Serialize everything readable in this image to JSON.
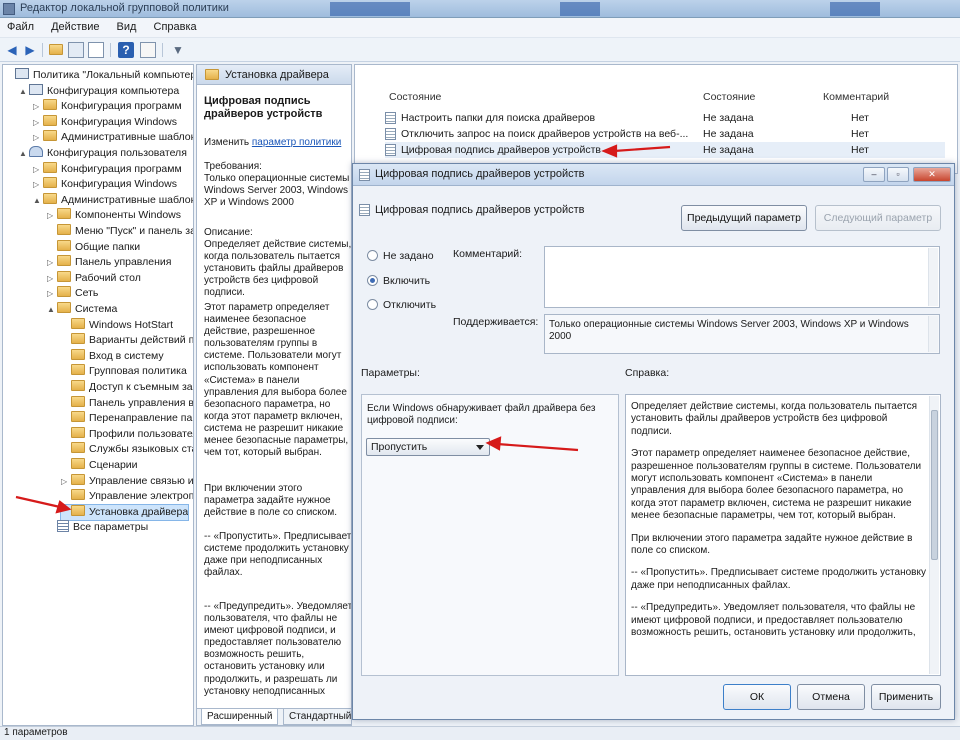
{
  "window": {
    "title": "Редактор локальной групповой политики"
  },
  "menu": {
    "items": [
      "Файл",
      "Действие",
      "Вид",
      "Справка"
    ]
  },
  "toolbar": {
    "icons": [
      "back-icon",
      "forward-icon",
      "up-folder-icon",
      "show-hide-tree-icon",
      "export-list-icon",
      "help-icon",
      "properties-icon",
      "filter-icon"
    ]
  },
  "tree": {
    "items": [
      {
        "label": "Политика \"Локальный компьютер\"",
        "indent": 0,
        "icon": "computer-policy-icon",
        "arrow": ""
      },
      {
        "label": "Конфигурация компьютера",
        "indent": 1,
        "icon": "computer-icon",
        "arrow": "▲"
      },
      {
        "label": "Конфигурация программ",
        "indent": 2,
        "icon": "folder-icon",
        "arrow": "▷"
      },
      {
        "label": "Конфигурация Windows",
        "indent": 2,
        "icon": "folder-icon",
        "arrow": "▷"
      },
      {
        "label": "Административные шаблоны",
        "indent": 2,
        "icon": "folder-icon",
        "arrow": "▷"
      },
      {
        "label": "Конфигурация пользователя",
        "indent": 1,
        "icon": "user-icon",
        "arrow": "▲"
      },
      {
        "label": "Конфигурация программ",
        "indent": 2,
        "icon": "folder-icon",
        "arrow": "▷"
      },
      {
        "label": "Конфигурация Windows",
        "indent": 2,
        "icon": "folder-icon",
        "arrow": "▷"
      },
      {
        "label": "Административные шаблоны",
        "indent": 2,
        "icon": "folder-icon",
        "arrow": "▲"
      },
      {
        "label": "Компоненты Windows",
        "indent": 3,
        "icon": "folder-icon",
        "arrow": "▷"
      },
      {
        "label": "Меню \"Пуск\" и панель за",
        "indent": 3,
        "icon": "folder-icon",
        "arrow": ""
      },
      {
        "label": "Общие папки",
        "indent": 3,
        "icon": "folder-icon",
        "arrow": ""
      },
      {
        "label": "Панель управления",
        "indent": 3,
        "icon": "folder-icon",
        "arrow": "▷"
      },
      {
        "label": "Рабочий стол",
        "indent": 3,
        "icon": "folder-icon",
        "arrow": "▷"
      },
      {
        "label": "Сеть",
        "indent": 3,
        "icon": "folder-icon",
        "arrow": "▷"
      },
      {
        "label": "Система",
        "indent": 3,
        "icon": "folder-icon",
        "arrow": "▲"
      },
      {
        "label": "Windows HotStart",
        "indent": 4,
        "icon": "folder-icon",
        "arrow": ""
      },
      {
        "label": "Варианты действий при",
        "indent": 4,
        "icon": "folder-icon",
        "arrow": ""
      },
      {
        "label": "Вход в систему",
        "indent": 4,
        "icon": "folder-icon",
        "arrow": ""
      },
      {
        "label": "Групповая политика",
        "indent": 4,
        "icon": "folder-icon",
        "arrow": ""
      },
      {
        "label": "Доступ к съемным запо",
        "indent": 4,
        "icon": "folder-icon",
        "arrow": ""
      },
      {
        "label": "Панель управления вво",
        "indent": 4,
        "icon": "folder-icon",
        "arrow": ""
      },
      {
        "label": "Перенаправление папок",
        "indent": 4,
        "icon": "folder-icon",
        "arrow": ""
      },
      {
        "label": "Профили пользователей",
        "indent": 4,
        "icon": "folder-icon",
        "arrow": ""
      },
      {
        "label": "Службы языковых стан",
        "indent": 4,
        "icon": "folder-icon",
        "arrow": ""
      },
      {
        "label": "Сценарии",
        "indent": 4,
        "icon": "folder-icon",
        "arrow": ""
      },
      {
        "label": "Управление связью и",
        "indent": 4,
        "icon": "folder-icon",
        "arrow": "▷"
      },
      {
        "label": "Управление электропит",
        "indent": 4,
        "icon": "folder-icon",
        "arrow": ""
      },
      {
        "label": "Установка драйвера",
        "indent": 4,
        "icon": "folder-icon",
        "arrow": "",
        "selected": true
      },
      {
        "label": "Все параметры",
        "indent": 3,
        "icon": "list-icon",
        "arrow": ""
      }
    ]
  },
  "middle": {
    "header": "Установка драйвера",
    "title": "Цифровая подпись драйверов устройств",
    "edit_prefix": "Изменить",
    "edit_link": "параметр политики",
    "req_label": "Требования:",
    "requirements": "Только операционные системы Windows Server 2003, Windows XP и Windows 2000",
    "desc_label": "Описание:",
    "desc1": "Определяет действие системы, когда пользователь пытается установить файлы драйверов устройств без цифровой подписи.",
    "desc2": "Этот параметр определяет наименее безопасное действие, разрешенное пользователям группы в системе. Пользователи могут использовать компонент «Система» в панели управления для выбора более безопасного параметра, но когда этот параметр включен, система не разрешит никакие менее безопасные параметры, чем тот, который выбран.",
    "desc3": "При включении этого параметра задайте нужное действие в поле со списком.",
    "desc4": "--   «Пропустить». Предписывает системе продолжить установку даже при неподписанных файлах.",
    "desc5": "--   «Предупредить». Уведомляет пользователя, что файлы не имеют цифровой подписи, и предоставляет пользователю возможность решить, остановить установку или продолжить, и разрешать ли установку неподписанных",
    "tabs": [
      "Расширенный",
      "Стандартный"
    ]
  },
  "list": {
    "columns": [
      "Состояние",
      "Состояние",
      "Комментарий"
    ],
    "rows": [
      {
        "name": "Настроить папки для поиска драйверов",
        "state": "Не задана",
        "comment": "Нет"
      },
      {
        "name": "Отключить запрос на поиск драйверов устройств на веб-...",
        "state": "Не задана",
        "comment": "Нет"
      },
      {
        "name": "Цифровая подпись драйверов устройств",
        "state": "Не задана",
        "comment": "Нет"
      }
    ]
  },
  "dialog": {
    "title": "Цифровая подпись драйверов устройств",
    "setting_name": "Цифровая подпись драйверов устройств",
    "prev_button": "Предыдущий параметр",
    "next_button": "Следующий параметр",
    "radio_not_set": "Не задано",
    "radio_enabled": "Включить",
    "radio_disabled": "Отключить",
    "comment_label": "Комментарий:",
    "supported_label": "Поддерживается:",
    "supported_text": "Только операционные системы Windows Server 2003, Windows XP и Windows 2000",
    "params_label": "Параметры:",
    "help_label": "Справка:",
    "param_text": "Если Windows обнаруживает файл драйвера без цифровой подписи:",
    "dropdown_value": "Пропустить",
    "help_p1": "Определяет действие системы, когда пользователь пытается установить файлы драйверов устройств без цифровой подписи.",
    "help_p2": "Этот параметр определяет наименее безопасное действие, разрешенное пользователям группы в системе. Пользователи могут использовать компонент «Система» в панели управления для выбора более безопасного параметра, но когда этот параметр включен, система не разрешит никакие менее безопасные параметры, чем тот, который выбран.",
    "help_p3": "При включении этого параметра задайте нужное действие в поле со списком.",
    "help_p4": "--   «Пропустить». Предписывает системе продолжить установку даже при неподписанных файлах.",
    "help_p5": "--   «Предупредить». Уведомляет пользователя, что файлы не имеют цифровой подписи, и предоставляет пользователю возможность решить, остановить установку или продолжить,",
    "ok_button": "ОК",
    "cancel_button": "Отмена",
    "apply_button": "Применить"
  },
  "status": {
    "text": "1 параметров"
  },
  "colors": {
    "annotation_arrow": "#d61a1a",
    "selection": "#cde4fb",
    "link": "#1a56b8"
  }
}
